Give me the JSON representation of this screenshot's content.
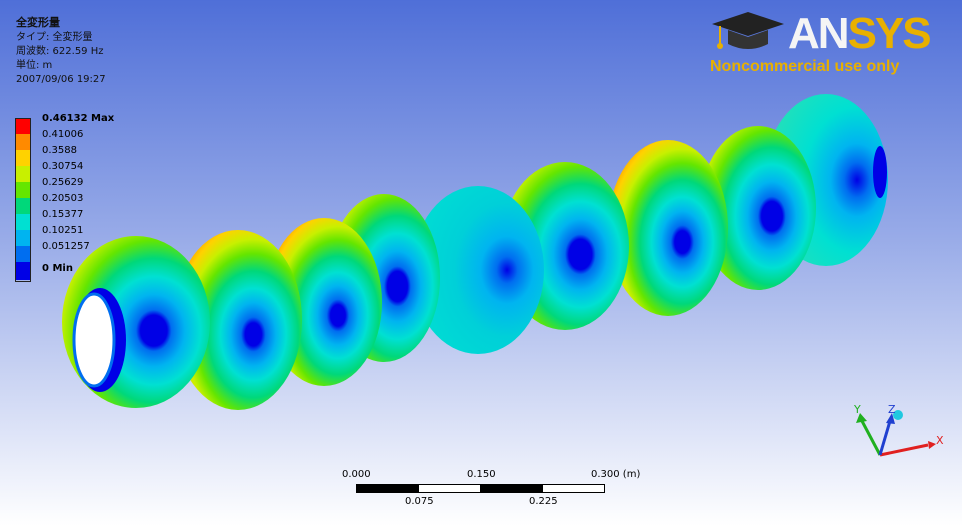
{
  "header": {
    "title": "全変形量",
    "type_line": "タイプ: 全変形量",
    "frequency_line": "周波数: 622.59 Hz",
    "unit_line": "単位: m",
    "date_line": "2007/09/06 19:27"
  },
  "legend": {
    "entries": [
      {
        "label": "0.46132 Max",
        "color": "#ff0000",
        "bold": true
      },
      {
        "label": "0.41006",
        "color": "#ff8a00"
      },
      {
        "label": "0.3588",
        "color": "#ffd200"
      },
      {
        "label": "0.30754",
        "color": "#c8f000"
      },
      {
        "label": "0.25629",
        "color": "#64e600"
      },
      {
        "label": "0.20503",
        "color": "#00d87a"
      },
      {
        "label": "0.15377",
        "color": "#00e0d2"
      },
      {
        "label": "0.10251",
        "color": "#00b4f0"
      },
      {
        "label": "0.051257",
        "color": "#006ef0"
      },
      {
        "label": "0 Min",
        "color": "#0000e6",
        "bold": true
      }
    ]
  },
  "logo": {
    "brand_an": "AN",
    "brand_sys": "SYS",
    "subtitle": "Noncommercial use only",
    "icon": "graduation-cap-icon"
  },
  "scale_bar": {
    "top_labels": [
      "0.000",
      "0.150",
      "0.300 (m)"
    ],
    "bottom_labels": [
      "0.075",
      "0.225"
    ]
  },
  "triad": {
    "x_label": "X",
    "y_label": "Y",
    "z_label": "Z",
    "x_color": "#e02020",
    "y_color": "#20b020",
    "z_color": "#2040d0"
  }
}
